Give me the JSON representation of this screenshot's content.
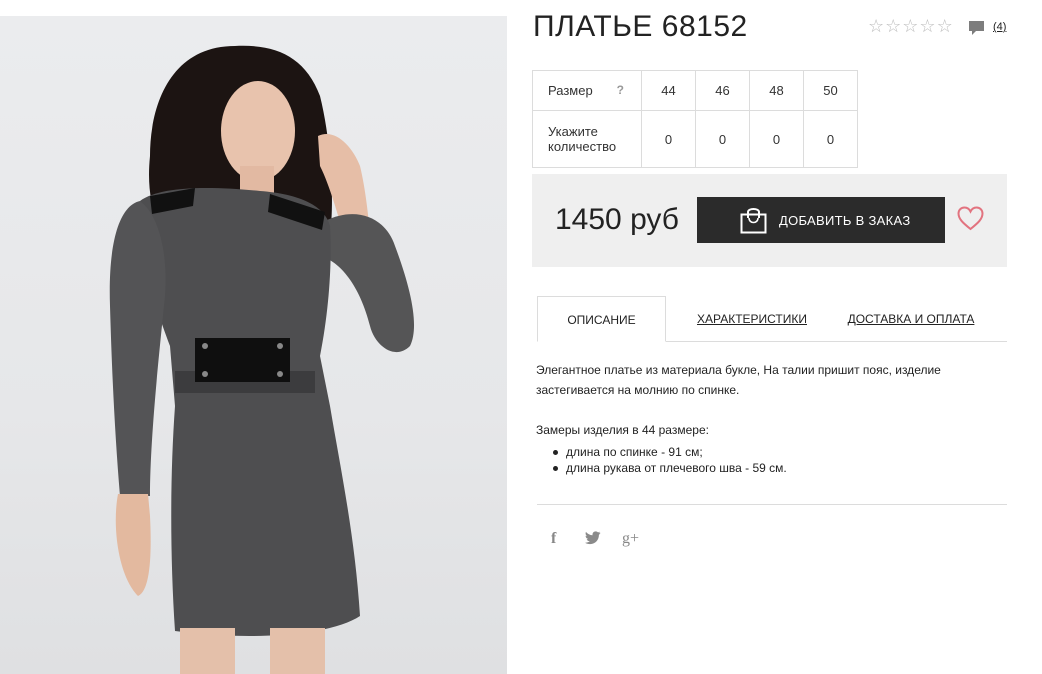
{
  "product": {
    "title": "ПЛАТЬЕ 68152",
    "rating_stars": 0,
    "rating_max": 5,
    "reviews_count": "(4)",
    "image_alt": "product-photo-dress"
  },
  "size_table": {
    "size_label": "Размер",
    "help_label": "?",
    "qty_label_line1": "Укажите",
    "qty_label_line2": "количество",
    "sizes": [
      "44",
      "46",
      "48",
      "50"
    ],
    "quantities": [
      "0",
      "0",
      "0",
      "0"
    ]
  },
  "purchase": {
    "price": "1450 руб",
    "add_button_label": "ДОБАВИТЬ В ЗАКАЗ",
    "bag_icon": "shopping-bag-icon",
    "wishlist_icon": "heart-icon",
    "accent_color": "#e2737f",
    "button_color": "#2b2b2b"
  },
  "tabs": [
    {
      "label": "ОПИСАНИЕ",
      "active": true
    },
    {
      "label": "ХАРАКТЕРИСТИКИ",
      "active": false
    },
    {
      "label": "ДОСТАВКА И ОПЛАТА",
      "active": false
    }
  ],
  "description": {
    "text": "Элегантное платье из материала букле, На талии пришит пояс, изделие застегивается на молнию по спинке.",
    "measure_title": "Замеры изделия в 44 размере:",
    "measures": [
      "длина по спинке - 91 см;",
      "длина рукава от плечевого шва - 59 см."
    ]
  },
  "social": {
    "facebook": "f",
    "twitter": "twitter-icon",
    "google": "g+"
  }
}
